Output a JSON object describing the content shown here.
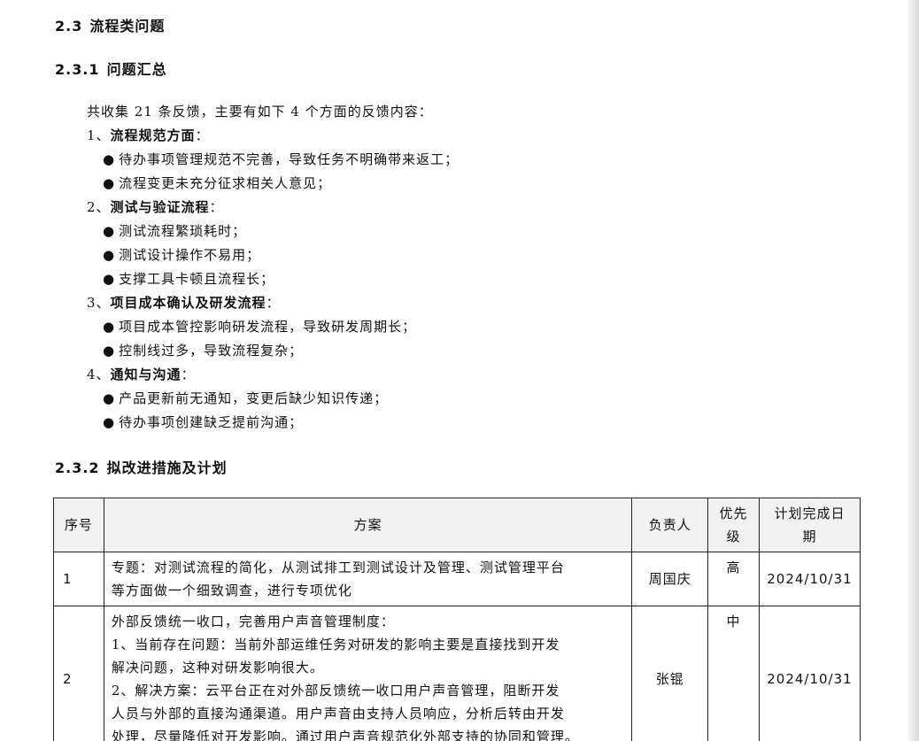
{
  "section": {
    "num": "2.3",
    "title": "流程类问题"
  },
  "summary": {
    "num": "2.3.1",
    "title": "问题汇总",
    "intro": "共收集 21 条反馈，主要有如下 4 个方面的反馈内容：",
    "categories": [
      {
        "prefix": "1、",
        "name": "流程规范方面",
        "suffix": "：",
        "items": [
          "待办事项管理规范不完善，导致任务不明确带来返工；",
          "流程变更未充分征求相关人意见；"
        ]
      },
      {
        "prefix": "2、",
        "name": "测试与验证流程",
        "suffix": "：",
        "items": [
          "测试流程繁琐耗时；",
          "测试设计操作不易用；",
          "支撑工具卡顿且流程长；"
        ]
      },
      {
        "prefix": "3、",
        "name": "项目成本确认及研发流程",
        "suffix": "：",
        "items": [
          "项目成本管控影响研发流程，导致研发周期长；",
          "控制线过多，导致流程复杂；"
        ]
      },
      {
        "prefix": "4、",
        "name": "通知与沟通",
        "suffix": "：",
        "items": [
          "产品更新前无通知，变更后缺少知识传递；",
          "待办事项创建缺乏提前沟通；"
        ]
      }
    ],
    "bullet": "●"
  },
  "plan": {
    "num": "2.3.2",
    "title": "拟改进措施及计划",
    "headers": {
      "no": "序号",
      "plan": "方案",
      "owner": "负责人",
      "prio_1": "优先",
      "prio_2": "级",
      "date_1": "计划完成日",
      "date_2": "期"
    },
    "rows": [
      {
        "no": "1",
        "lines": [
          "专题：对测试流程的简化，从测试排工到测试设计及管理、测试管理平台",
          "等方面做一个细致调查，进行专项优化"
        ],
        "owner": "周国庆",
        "priority": "高",
        "date": "2024/10/31"
      },
      {
        "no": "2",
        "lines": [
          "外部反馈统一收口，完善用户声音管理制度：",
          "1、当前存在问题：当前外部运维任务对研发的影响主要是直接找到开发",
          "解决问题，这种对研发影响很大。",
          "2、解决方案：云平台正在对外部反馈统一收口用户声音管理，阻断开发",
          "人员与外部的直接沟通渠道。用户声音由支持人员响应，分析后转由开发",
          "处理，尽量降低对开发影响。通过用户声音规范化外部支持的协同和管理。"
        ],
        "owner": "张锟",
        "priority": "中",
        "date": "2024/10/31"
      }
    ]
  }
}
